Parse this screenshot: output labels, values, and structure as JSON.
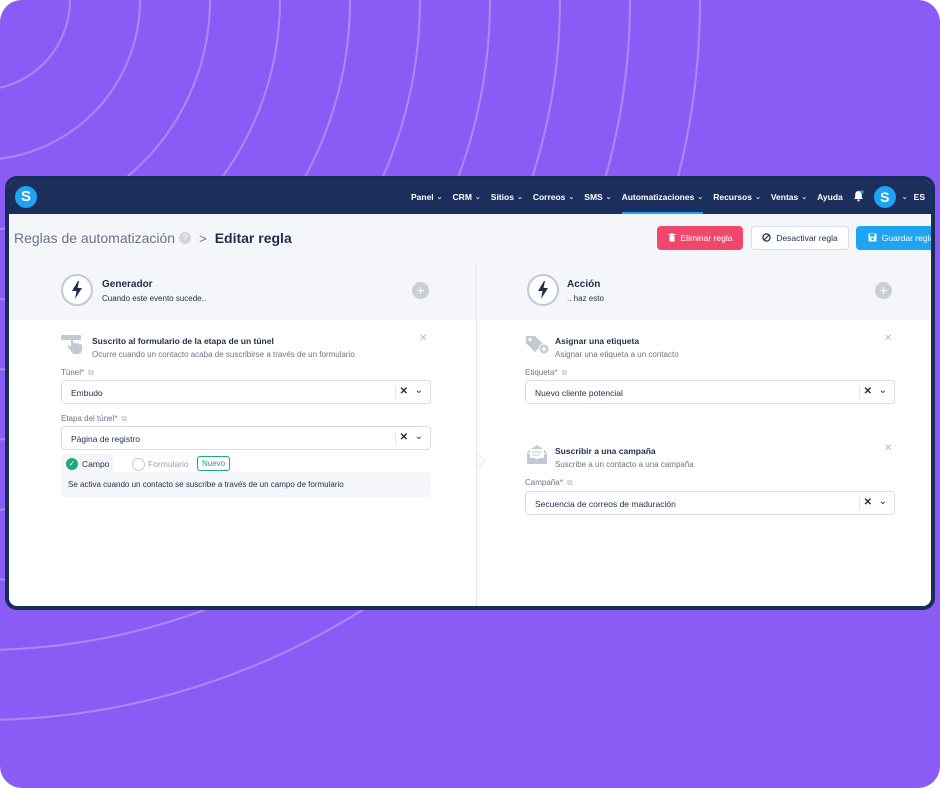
{
  "nav": {
    "logo": "S",
    "items": [
      {
        "label": "Panel",
        "chevron": true
      },
      {
        "label": "CRM",
        "chevron": true
      },
      {
        "label": "Sitios",
        "chevron": true
      },
      {
        "label": "Correos",
        "chevron": true
      },
      {
        "label": "SMS",
        "chevron": true
      },
      {
        "label": "Automatizaciones",
        "chevron": true,
        "active": true
      },
      {
        "label": "Recursos",
        "chevron": true
      },
      {
        "label": "Ventas",
        "chevron": true
      },
      {
        "label": "Ayuda",
        "chevron": false
      }
    ],
    "avatar": "S",
    "language": "ES"
  },
  "breadcrumb": {
    "parent": "Reglas de automatización",
    "current": "Editar regla"
  },
  "buttons": {
    "delete": "Eliminar regla",
    "deactivate": "Desactivar regla",
    "save": "Guardar regla"
  },
  "trigger_panel": {
    "title": "Generador",
    "subtitle": "Cuando este evento sucede..",
    "card": {
      "title": "Suscrito al formulario de la etapa de un túnel",
      "description": "Ocurre cuando un contacto acaba de suscribirse a través de un formulario"
    },
    "fields": [
      {
        "label": "Túnel",
        "value": "Embudo"
      },
      {
        "label": "Etapa del túnel",
        "value": "Página de registro"
      }
    ],
    "tabs": {
      "selected": "Campo",
      "other": "Formulario",
      "badge": "Nuevo",
      "description": "Se activa cuando un contacto se suscribe a través de un campo de formulario"
    }
  },
  "action_panel": {
    "title": "Acción",
    "subtitle": ".. haz esto",
    "actions": [
      {
        "title": "Asignar una etiqueta",
        "description": "Asignar una etiqueta a un contacto",
        "field_label": "Etiqueta",
        "value": "Nuevo cliente potencial"
      },
      {
        "title": "Suscribir a una campaña",
        "description": "Suscribe a un contacto a una campaña",
        "field_label": "Campaña",
        "value": "Secuencia de correos de maduración"
      }
    ]
  },
  "colors": {
    "background": "#8a5cf5",
    "nav": "#1c2e5c",
    "accent": "#1ea4f3",
    "danger": "#f0486c",
    "success": "#1ea97c"
  }
}
